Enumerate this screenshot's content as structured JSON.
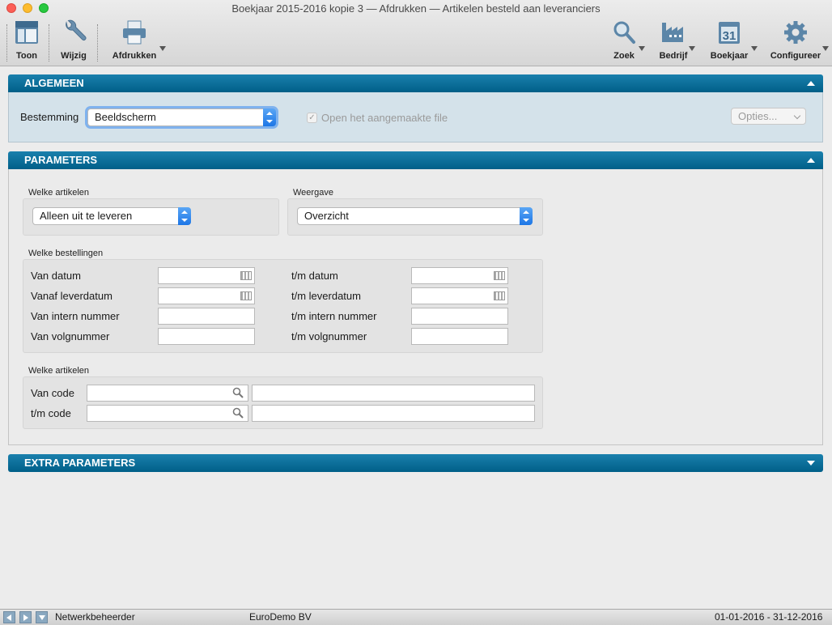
{
  "window": {
    "title": "Boekjaar 2015-2016 kopie 3 — Afdrukken — Artikelen besteld aan leveranciers"
  },
  "toolbar": {
    "left": [
      {
        "label": "Toon",
        "icon": "view-icon"
      },
      {
        "label": "Wijzig",
        "icon": "wrench-icon"
      },
      {
        "label": "Afdrukken",
        "icon": "printer-icon"
      }
    ],
    "right": [
      {
        "label": "Zoek",
        "icon": "search-icon"
      },
      {
        "label": "Bedrijf",
        "icon": "factory-icon"
      },
      {
        "label": "Boekjaar",
        "icon": "calendar-icon",
        "calendar_day": "31"
      },
      {
        "label": "Configureer",
        "icon": "gear-icon"
      }
    ]
  },
  "algemeen": {
    "header": "ALGEMEEN",
    "bestemming_label": "Bestemming",
    "bestemming_value": "Beeldscherm",
    "open_file_label": "Open het aangemaakte file",
    "open_file_checked": true,
    "opties_label": "Opties..."
  },
  "parameters": {
    "header": "PARAMETERS",
    "welke_artikelen_label": "Welke artikelen",
    "welke_artikelen_value": "Alleen uit te leveren",
    "weergave_label": "Weergave",
    "weergave_value": "Overzicht",
    "welke_bestellingen_label": "Welke bestellingen",
    "rows": [
      {
        "from_label": "Van datum",
        "to_label": "t/m datum",
        "calendar": true
      },
      {
        "from_label": "Vanaf leverdatum",
        "to_label": "t/m leverdatum",
        "calendar": true
      },
      {
        "from_label": "Van intern nummer",
        "to_label": "t/m intern nummer",
        "calendar": false
      },
      {
        "from_label": "Van volgnummer",
        "to_label": "t/m volgnummer",
        "calendar": false
      }
    ],
    "welke_artikelen2_label": "Welke artikelen",
    "code_rows": [
      {
        "label": "Van code"
      },
      {
        "label": "t/m code"
      }
    ]
  },
  "extra": {
    "header": "EXTRA PARAMETERS"
  },
  "statusbar": {
    "user": "Netwerkbeheerder",
    "company": "EuroDemo BV",
    "period": "01-01-2016 - 31-12-2016"
  },
  "colors": {
    "section_header": "#006a96",
    "accent_blue": "#1d76e6"
  }
}
